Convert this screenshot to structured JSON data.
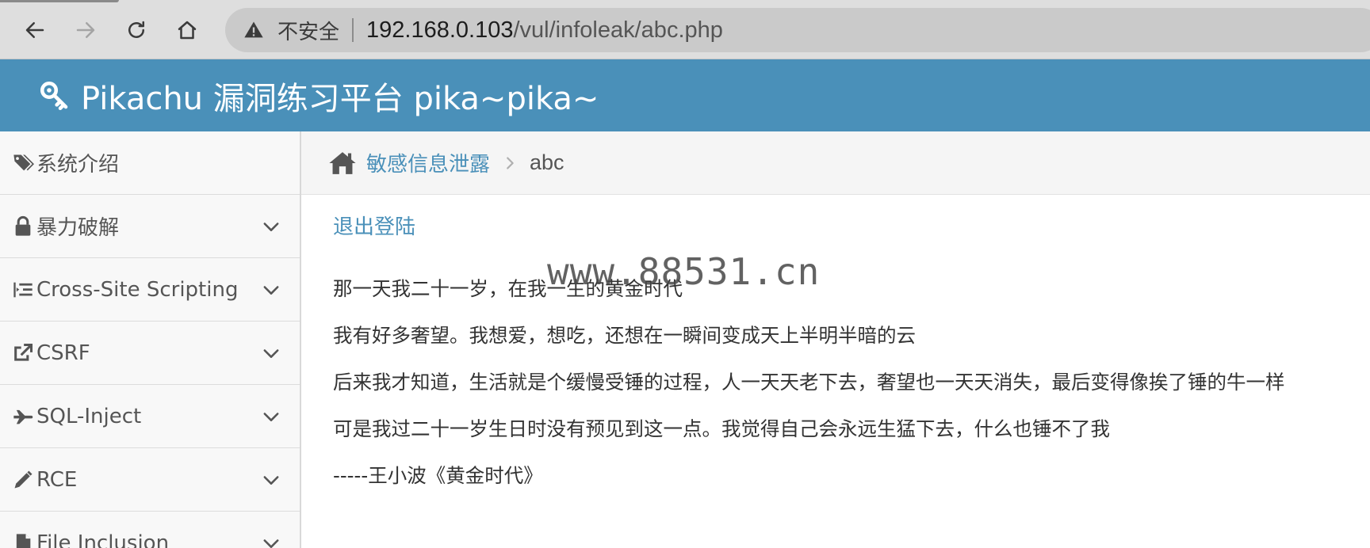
{
  "browser": {
    "insecure_label": "不安全",
    "url_host": "192.168.0.103",
    "url_path": "/vul/infoleak/abc.php"
  },
  "header": {
    "title": "Pikachu 漏洞练习平台 pika~pika~"
  },
  "sidebar": {
    "items": [
      {
        "label": "系统介绍",
        "icon": "tags-icon"
      },
      {
        "label": "暴力破解",
        "icon": "lock-icon"
      },
      {
        "label": "Cross-Site Scripting",
        "icon": "indent-icon"
      },
      {
        "label": "CSRF",
        "icon": "share-icon"
      },
      {
        "label": "SQL-Inject",
        "icon": "plane-icon"
      },
      {
        "label": "RCE",
        "icon": "pencil-icon"
      },
      {
        "label": "File Inclusion",
        "icon": "file-icon"
      }
    ]
  },
  "breadcrumb": {
    "parent": "敏感信息泄露",
    "current": "abc"
  },
  "main": {
    "logout_label": "退出登陆",
    "watermark": "www.88531.cn",
    "lines": [
      "那一天我二十一岁，在我一生的黄金时代",
      "我有好多奢望。我想爱，想吃，还想在一瞬间变成天上半明半暗的云",
      "后来我才知道，生活就是个缓慢受锤的过程，人一天天老下去，奢望也一天天消失，最后变得像挨了锤的牛一样",
      "可是我过二十一岁生日时没有预见到这一点。我觉得自己会永远生猛下去，什么也锤不了我",
      "-----王小波《黄金时代》"
    ]
  },
  "colors": {
    "brand_blue": "#4a90b9",
    "text_gray": "#555555"
  }
}
